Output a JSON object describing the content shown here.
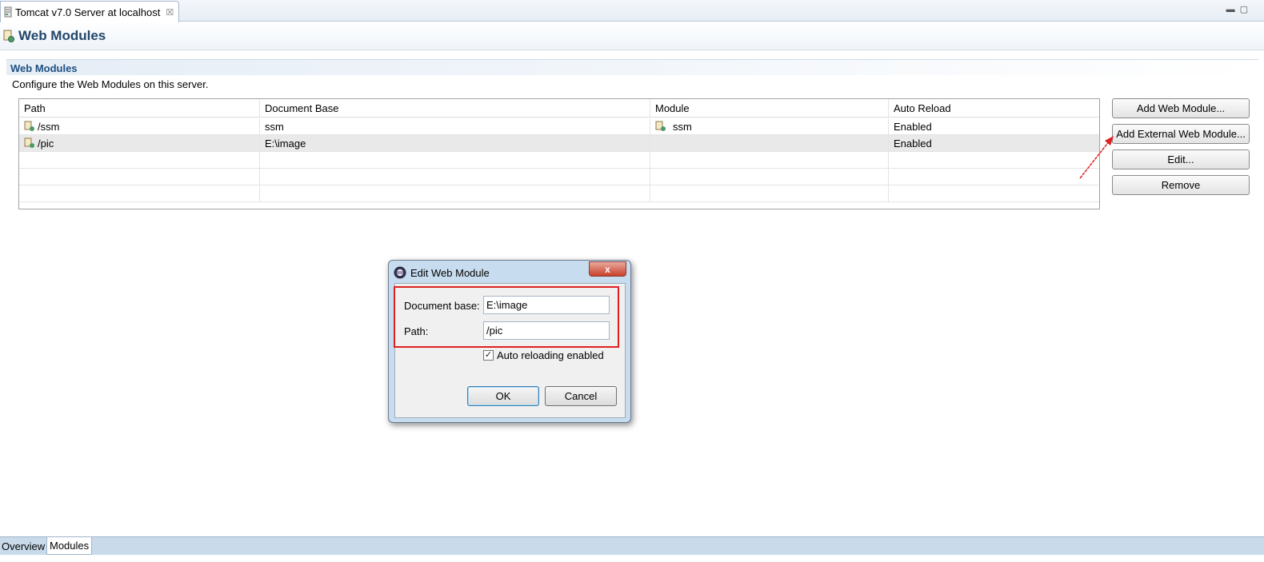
{
  "editor_tab": {
    "title": "Tomcat v7.0 Server at localhost"
  },
  "header": {
    "title": "Web Modules"
  },
  "section": {
    "title": "Web Modules",
    "description": "Configure the Web Modules on this server."
  },
  "table": {
    "headers": [
      "Path",
      "Document Base",
      "Module",
      "Auto Reload"
    ],
    "rows": [
      {
        "path": "/ssm",
        "document_base": "ssm",
        "module": "ssm",
        "auto_reload": "Enabled"
      },
      {
        "path": "/pic",
        "document_base": "E:\\image",
        "module": "",
        "auto_reload": "Enabled"
      }
    ]
  },
  "buttons": {
    "add_web_module": "Add Web Module...",
    "add_external_web_module": "Add External Web Module...",
    "edit": "Edit...",
    "remove": "Remove"
  },
  "dialog": {
    "title": "Edit Web Module",
    "close_glyph": "x",
    "document_base_label": "Document base:",
    "document_base_value": "E:\\image",
    "path_label": "Path:",
    "path_value": "/pic",
    "auto_reload_label": "Auto reloading enabled",
    "auto_reload_checked": true,
    "ok": "OK",
    "cancel": "Cancel"
  },
  "bottom_tabs": [
    "Overview",
    "Modules"
  ],
  "colors": {
    "header_title": "#22466b",
    "section_title": "#1f4f80",
    "annotation_red": "#e02020"
  }
}
